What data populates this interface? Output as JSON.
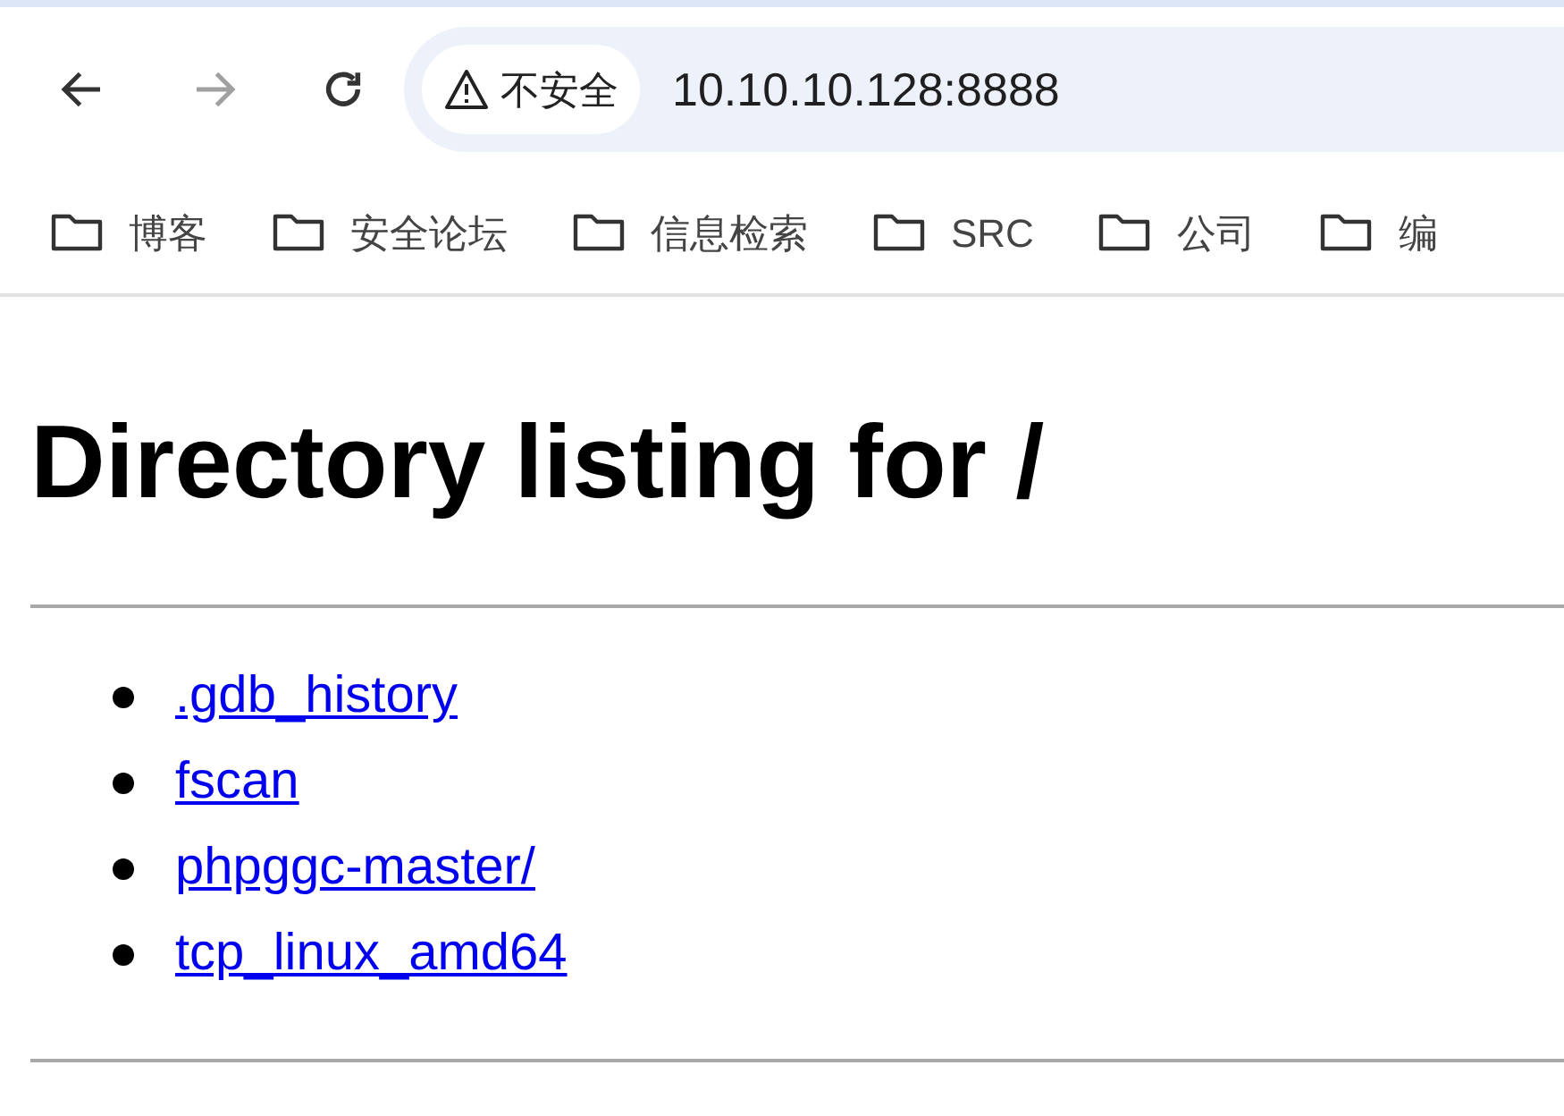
{
  "toolbar": {
    "back": {
      "disabled": false
    },
    "forward": {
      "disabled": true
    },
    "security_chip": "不安全",
    "address": "10.10.10.128:8888"
  },
  "bookmarks": [
    "博客",
    "安全论坛",
    "信息检索",
    "SRC",
    "公司",
    "编"
  ],
  "page": {
    "heading": "Directory listing for /",
    "links": [
      ".gdb_history",
      "fscan",
      "phpggc-master/",
      "tcp_linux_amd64"
    ]
  }
}
